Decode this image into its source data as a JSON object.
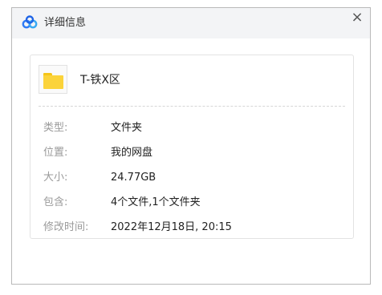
{
  "dialog": {
    "title": "详细信息",
    "app_icon": "baidu-netdisk-logo-icon",
    "close_label": "×",
    "accent_color": "#2f7bf5"
  },
  "file": {
    "icon": "folder-icon",
    "name": "T-铁X区"
  },
  "details": [
    {
      "label": "类型:",
      "value": "文件夹"
    },
    {
      "label": "位置:",
      "value": "我的网盘"
    },
    {
      "label": "大小:",
      "value": "24.77GB"
    },
    {
      "label": "包含:",
      "value": "4个文件,1个文件夹"
    },
    {
      "label": "修改时间:",
      "value": "2022年12月18日, 20:15"
    }
  ]
}
